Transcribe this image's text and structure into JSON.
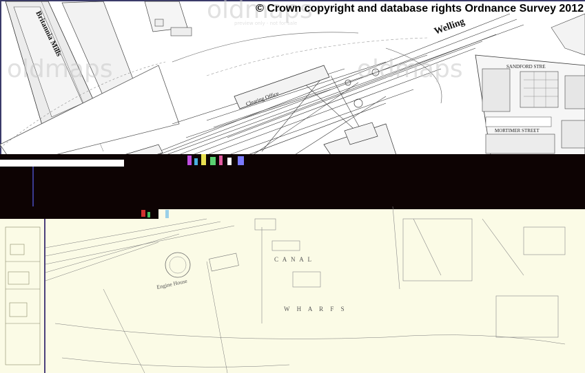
{
  "map": {
    "copyright": "© Crown copyright and database rights Ordnance Survey 2012",
    "labels": {
      "britannia_mills": "Britannia Mills",
      "clearing_office": "Clearing Office",
      "wellington": "Welling",
      "sandford_street": "SANDFORD STRE",
      "mortimer_street": "MORTIMER STREET",
      "engine_house": "Engine House",
      "canal": "C  A  N  A  L",
      "wharfs": "W  H  A  R  F  S"
    },
    "watermark": {
      "brand": "oldmaps",
      "preview_note": "preview only - not for sale"
    },
    "colors": {
      "upper_paper": "#ffffff",
      "lower_paper": "#fbfbe6",
      "glitch_band": "#0d0303",
      "border_line": "#4b3f7a"
    }
  }
}
